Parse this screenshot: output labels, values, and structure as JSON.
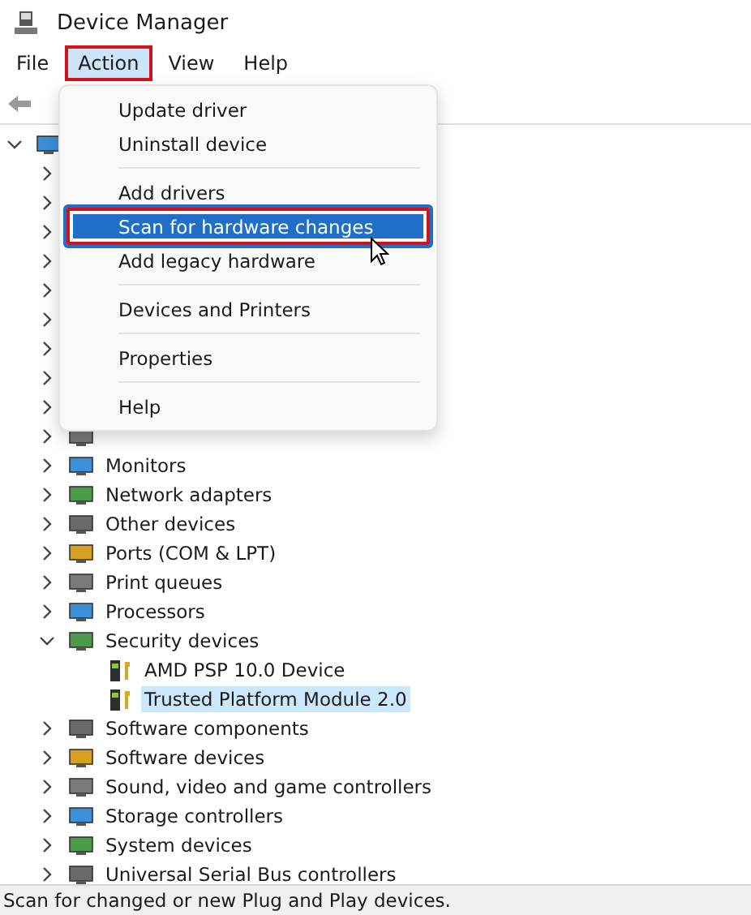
{
  "window": {
    "title": "Device Manager"
  },
  "menubar": [
    {
      "label": "File",
      "selected": false
    },
    {
      "label": "Action",
      "selected": true,
      "annotated": true
    },
    {
      "label": "View",
      "selected": false
    },
    {
      "label": "Help",
      "selected": false
    }
  ],
  "action_menu": [
    {
      "kind": "item",
      "label": "Update driver",
      "selected": false
    },
    {
      "kind": "item",
      "label": "Uninstall device",
      "selected": false
    },
    {
      "kind": "separator"
    },
    {
      "kind": "item",
      "label": "Add drivers",
      "selected": false
    },
    {
      "kind": "item",
      "label": "Scan for hardware changes",
      "selected": true,
      "annotated": true
    },
    {
      "kind": "item",
      "label": "Add legacy hardware",
      "selected": false
    },
    {
      "kind": "separator"
    },
    {
      "kind": "item",
      "label": "Devices and Printers",
      "selected": false
    },
    {
      "kind": "separator"
    },
    {
      "kind": "item",
      "label": "Properties",
      "selected": false
    },
    {
      "kind": "separator"
    },
    {
      "kind": "item",
      "label": "Help",
      "selected": false
    }
  ],
  "tree": [
    {
      "expanded": true,
      "children": [
        {
          "expanded": false
        },
        {
          "expanded": false
        },
        {
          "expanded": false
        },
        {
          "expanded": false
        },
        {
          "expanded": false
        },
        {
          "expanded": false
        },
        {
          "expanded": false
        },
        {
          "expanded": false
        },
        {
          "expanded": false
        },
        {
          "expanded": false
        },
        {
          "label": "Monitors",
          "expanded": false
        },
        {
          "label": "Network adapters",
          "expanded": false
        },
        {
          "label": "Other devices",
          "expanded": false
        },
        {
          "label": "Ports (COM & LPT)",
          "expanded": false
        },
        {
          "label": "Print queues",
          "expanded": false
        },
        {
          "label": "Processors",
          "expanded": false
        },
        {
          "label": "Security devices",
          "expanded": true,
          "children": [
            {
              "label": "AMD PSP 10.0 Device",
              "selected": false
            },
            {
              "label": "Trusted Platform Module 2.0",
              "selected": true
            }
          ]
        },
        {
          "label": "Software components",
          "expanded": false
        },
        {
          "label": "Software devices",
          "expanded": false
        },
        {
          "label": "Sound, video and game controllers",
          "expanded": false
        },
        {
          "label": "Storage controllers",
          "expanded": false
        },
        {
          "label": "System devices",
          "expanded": false
        },
        {
          "label": "Universal Serial Bus controllers",
          "expanded": false
        }
      ]
    }
  ],
  "status_bar": {
    "text": "Scan for changed or new Plug and Play devices."
  }
}
